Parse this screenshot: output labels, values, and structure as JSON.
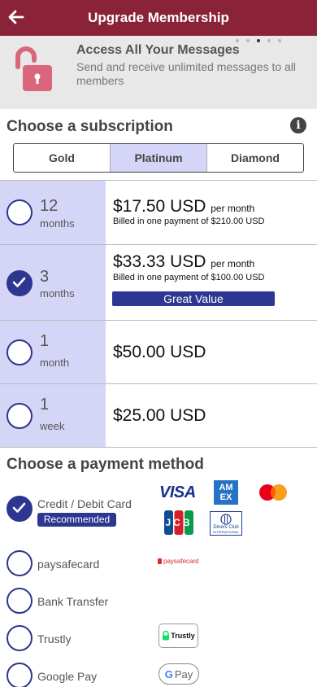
{
  "header": {
    "title": "Upgrade Membership",
    "back_icon": "arrow-left-icon"
  },
  "banner": {
    "title": "Access All Your Messages",
    "text": "Send and receive unlimited messages to all members",
    "icon": "unlocked-padlock-icon",
    "carousel_pages": 5,
    "carousel_active": 2
  },
  "subscription": {
    "title": "Choose a subscription",
    "tabs": [
      {
        "label": "Gold",
        "active": false
      },
      {
        "label": "Platinum",
        "active": true
      },
      {
        "label": "Diamond",
        "active": false
      }
    ],
    "plans": [
      {
        "num": "12",
        "unit": "months",
        "price": "$17.50 USD",
        "per": "per month",
        "billed": "Billed in one payment of $210.00 USD",
        "selected": false
      },
      {
        "num": "3",
        "unit": "months",
        "price": "$33.33 USD",
        "per": "per month",
        "billed": "Billed in one payment of $100.00 USD",
        "badge": "Great Value",
        "selected": true
      },
      {
        "num": "1",
        "unit": "month",
        "price": "$50.00 USD",
        "selected": false
      },
      {
        "num": "1",
        "unit": "week",
        "price": "$25.00 USD",
        "selected": false
      }
    ]
  },
  "payment": {
    "title": "Choose a payment method",
    "methods": [
      {
        "label": "Credit / Debit Card",
        "badge": "Recommended",
        "selected": true
      },
      {
        "label": "paysafecard",
        "selected": false
      },
      {
        "label": "Bank Transfer",
        "selected": false
      },
      {
        "label": "Trustly",
        "selected": false
      },
      {
        "label": "Google Pay",
        "selected": false
      }
    ],
    "logos": {
      "visa": "VISA",
      "amex_line1": "AM",
      "amex_line2": "EX",
      "jcb": "JCB",
      "diners": "Diners Club",
      "diners_sub": "INTERNATIONAL",
      "paysafecard": "paysafecard",
      "trustly": "Trustly",
      "gpay_g": "G",
      "gpay": "Pay"
    }
  },
  "colors": {
    "header": "#8a2238",
    "accent": "#2d3690",
    "selected_bg": "#d5d6f7",
    "banner_bg": "#e8e8e8"
  }
}
